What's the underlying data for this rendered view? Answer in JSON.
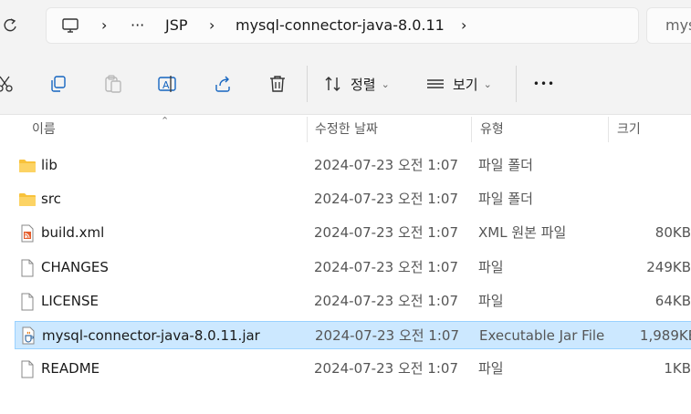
{
  "address": {
    "breadcrumbs": [
      "JSP",
      "mysql-connector-java-8.0.11"
    ],
    "more": "···",
    "separator": "›",
    "search_placeholder": "mys"
  },
  "toolbar": {
    "sort_label": "정렬",
    "view_label": "보기",
    "more_label": "•••"
  },
  "columns": {
    "name": "이름",
    "date": "수정한 날짜",
    "type": "유형",
    "size": "크기"
  },
  "files": [
    {
      "name": "lib",
      "date": "2024-07-23 오전 1:07",
      "type": "파일 폴더",
      "size": "",
      "icon": "folder-icon"
    },
    {
      "name": "src",
      "date": "2024-07-23 오전 1:07",
      "type": "파일 폴더",
      "size": "",
      "icon": "folder-icon"
    },
    {
      "name": "build.xml",
      "date": "2024-07-23 오전 1:07",
      "type": "XML 원본 파일",
      "size": "80KB",
      "icon": "xml-file-icon"
    },
    {
      "name": "CHANGES",
      "date": "2024-07-23 오전 1:07",
      "type": "파일",
      "size": "249KB",
      "icon": "file-icon"
    },
    {
      "name": "LICENSE",
      "date": "2024-07-23 오전 1:07",
      "type": "파일",
      "size": "64KB",
      "icon": "file-icon"
    },
    {
      "name": "mysql-connector-java-8.0.11.jar",
      "date": "2024-07-23 오전 1:07",
      "type": "Executable Jar File",
      "size": "1,989KB",
      "icon": "jar-file-icon",
      "selected": true
    },
    {
      "name": "README",
      "date": "2024-07-23 오전 1:07",
      "type": "파일",
      "size": "1KB",
      "icon": "file-icon"
    }
  ],
  "colors": {
    "selection_bg": "#cce8ff",
    "selection_border": "#99d1ff",
    "folder": "#f8c23b"
  }
}
